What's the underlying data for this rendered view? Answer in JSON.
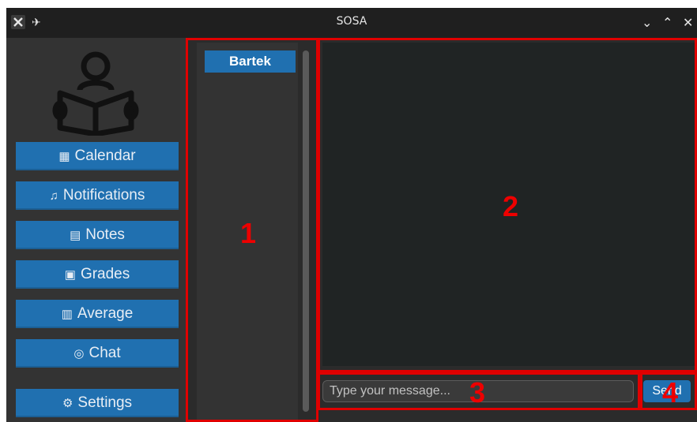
{
  "window": {
    "title": "SOSA"
  },
  "sidebar": {
    "items": [
      {
        "label": "Calendar",
        "icon": "calendar-icon",
        "glyph": "▦"
      },
      {
        "label": "Notifications",
        "icon": "bell-icon",
        "glyph": "♫"
      },
      {
        "label": "Notes",
        "icon": "notes-icon",
        "glyph": "▤"
      },
      {
        "label": "Grades",
        "icon": "grades-icon",
        "glyph": "▣"
      },
      {
        "label": "Average",
        "icon": "chart-icon",
        "glyph": "▥"
      },
      {
        "label": "Chat",
        "icon": "chat-bubbles-icon",
        "glyph": "◎"
      }
    ],
    "settings": {
      "label": "Settings",
      "icon": "gear-icon",
      "glyph": "⚙"
    }
  },
  "contacts": [
    {
      "name": "Bartek"
    }
  ],
  "composer": {
    "placeholder": "Type your message...",
    "send_label": "Send"
  },
  "annotations": [
    {
      "label": "1"
    },
    {
      "label": "2"
    },
    {
      "label": "3"
    },
    {
      "label": "4"
    }
  ],
  "colors": {
    "accent": "#2070b0",
    "annotation": "#e00000",
    "titlebar": "#1f1f1f",
    "sidebar": "#333333",
    "chat_bg": "#202424"
  }
}
